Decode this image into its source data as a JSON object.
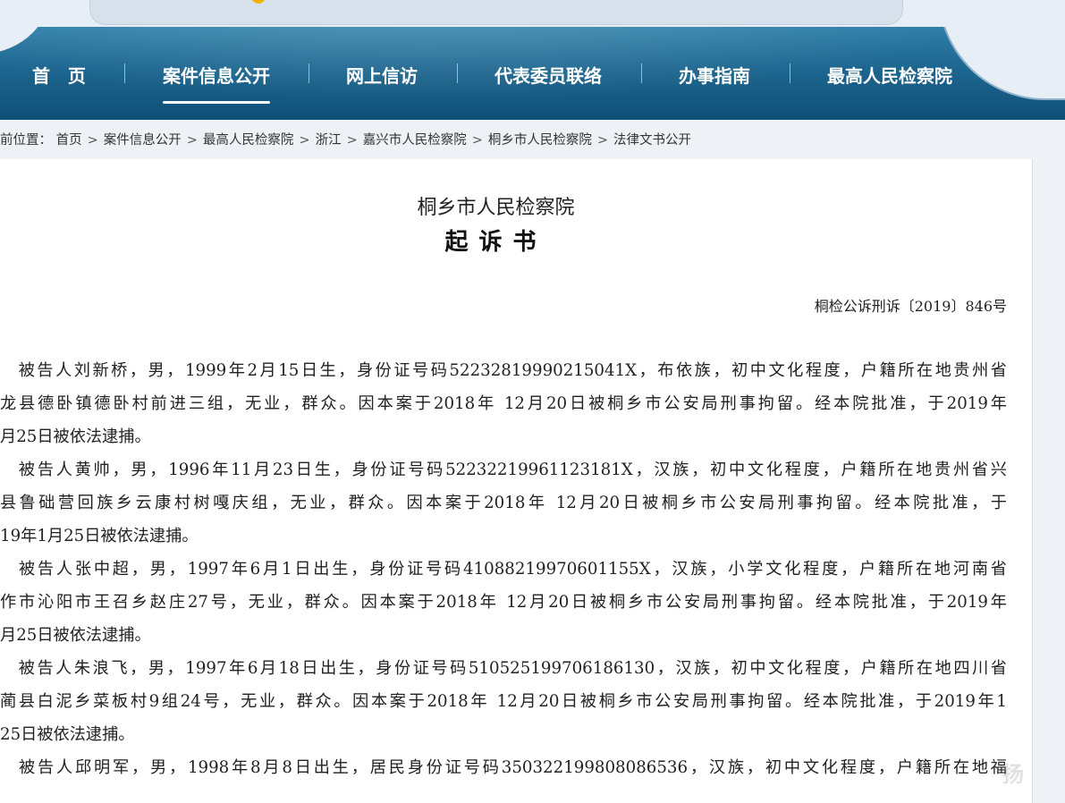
{
  "nav": {
    "items": [
      "首　页",
      "案件信息公开",
      "网上信访",
      "代表委员联络",
      "办事指南",
      "最高人民检察院"
    ],
    "active": "案件信息公开"
  },
  "breadcrumb": {
    "prefix": "前位置：",
    "items": [
      "首页",
      "案件信息公开",
      "最高人民检察院",
      "浙江",
      "嘉兴市人民检察院",
      "桐乡市人民检察院",
      "法律文书公开"
    ],
    "separator": ">"
  },
  "document": {
    "org": "桐乡市人民检察院",
    "title": "起诉书",
    "number": "桐检公诉刑诉〔2019〕846号",
    "lines": [
      "　被告人刘新桥，男，1999年2月15日生，身份证号码52232819990215041X，布依族，初中文化程度，户籍所在地贵州省",
      "龙县德卧镇德卧村前进三组，无业，群众。因本案于2018年 12月20日被桐乡市公安局刑事拘留。经本院批准，于2019年",
      "月25日被依法逮捕。",
      "　被告人黄帅，男，1996年11月23日生，身份证号码52232219961123181X，汉族，初中文化程度，户籍所在地贵州省兴",
      "县鲁础营回族乡云康村树嘎庆组，无业，群众。因本案于2018年 12月20日被桐乡市公安局刑事拘留。经本院批准，于",
      "19年1月25日被依法逮捕。",
      "　被告人张中超，男，1997年6月1日出生，身份证号码41088219970601155X，汉族，小学文化程度，户籍所在地河南省",
      "作市沁阳市王召乡赵庄27号，无业，群众。因本案于2018年 12月20日被桐乡市公安局刑事拘留。经本院批准，于2019年",
      "月25日被依法逮捕。",
      "　被告人朱浪飞，男，1997年6月18日出生，身份证号码510525199706186130，汉族，初中文化程度，户籍所在地四川省",
      "蔺县白泥乡菜板村9组24号，无业，群众。因本案于2018年 12月20日被桐乡市公安局刑事拘留。经本院批准，于2019年1",
      "25日被依法逮捕。",
      "　被告人邱明军，男，1998年8月8日出生，居民身份证号码350322199808086536，汉族，初中文化程度，户籍所在地福"
    ]
  },
  "watermark": "扬"
}
